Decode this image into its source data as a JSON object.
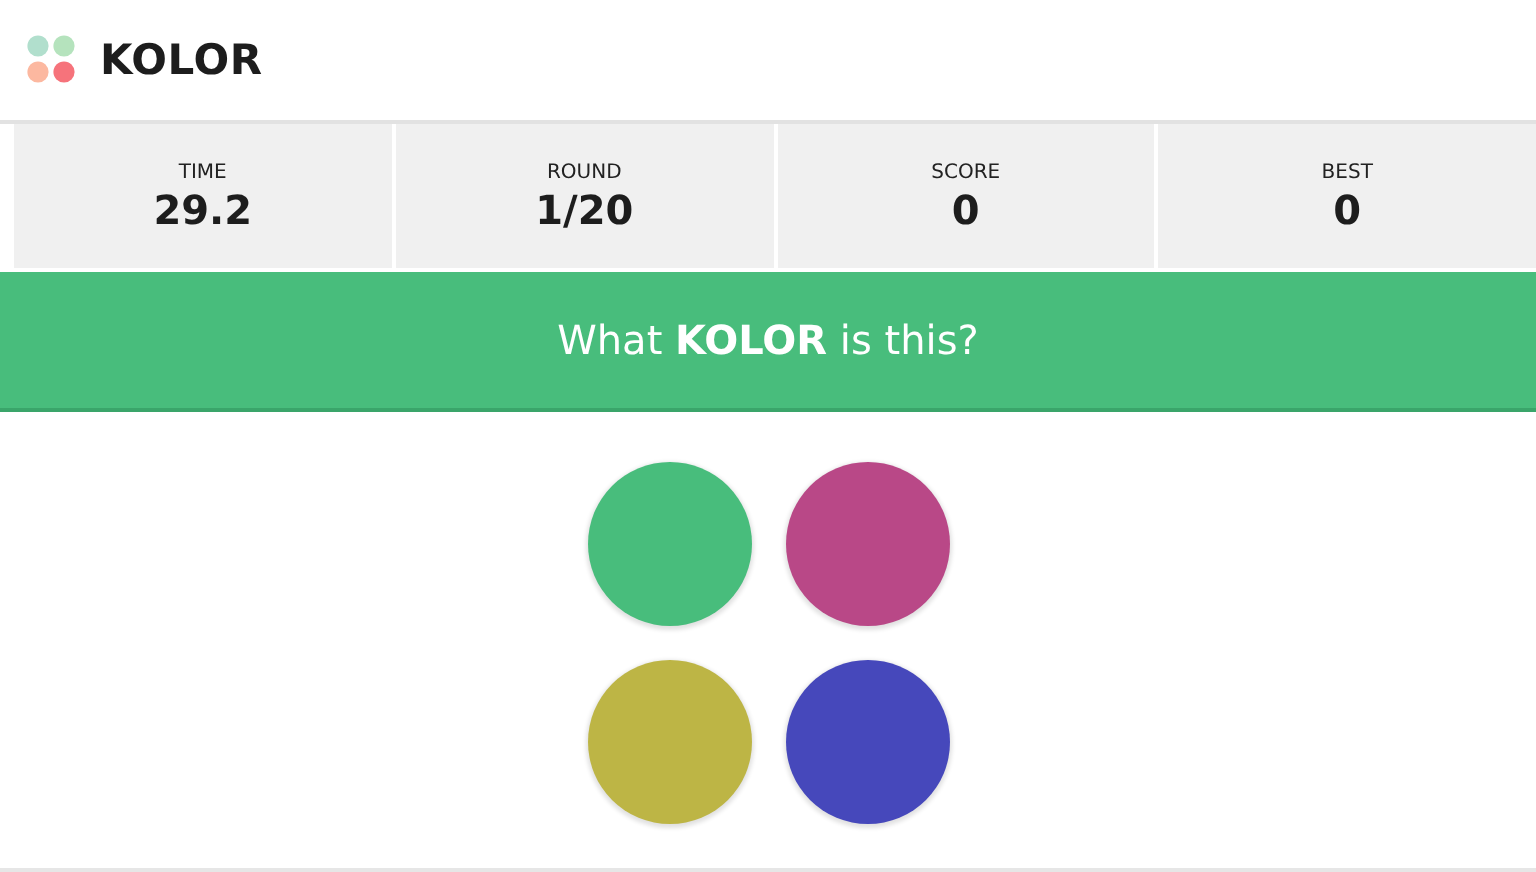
{
  "header": {
    "title": "KOLOR"
  },
  "stats": [
    {
      "label": "TIME",
      "value": "29.2"
    },
    {
      "label": "ROUND",
      "value": "1/20"
    },
    {
      "label": "SCORE",
      "value": "0"
    },
    {
      "label": "BEST",
      "value": "0"
    }
  ],
  "question": "What **KOLOR** is this?",
  "choices": [
    {
      "color": "#48bd7c"
    },
    {
      "color": "#b94887"
    },
    {
      "color": "#bdb545"
    },
    {
      "color": "#4648bb"
    }
  ]
}
